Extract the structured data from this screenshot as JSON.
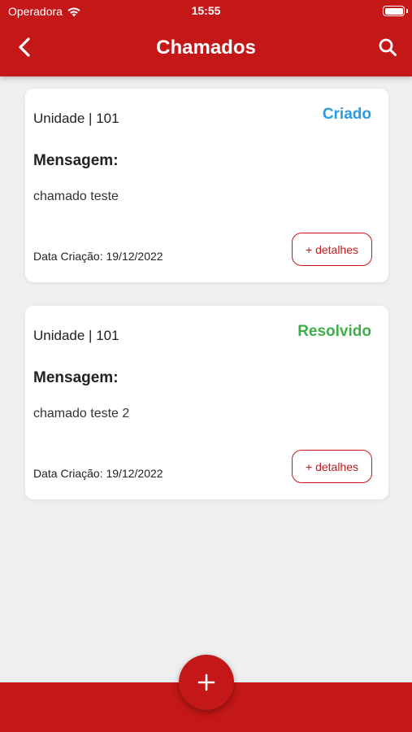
{
  "status_bar": {
    "carrier": "Operadora",
    "time": "15:55",
    "wifi_icon": "wifi-icon",
    "battery_icon": "battery-full-icon"
  },
  "header": {
    "title": "Chamados",
    "back_icon": "chevron-left-icon",
    "search_icon": "search-icon"
  },
  "colors": {
    "primary": "#c41717",
    "status_created": "#2b9be3",
    "status_resolved": "#3fae4a",
    "background": "#efefef"
  },
  "tickets": [
    {
      "unit": "Unidade | 101",
      "status": "Criado",
      "message_label": "Mensagem:",
      "message": "chamado teste",
      "date": "Data Criação: 19/12/2022",
      "details_label": "+ detalhes"
    },
    {
      "unit": "Unidade | 101",
      "status": "Resolvido",
      "message_label": "Mensagem:",
      "message": "chamado teste 2",
      "date": "Data Criação: 19/12/2022",
      "details_label": "+ detalhes"
    }
  ],
  "fab": {
    "icon": "plus-icon"
  }
}
